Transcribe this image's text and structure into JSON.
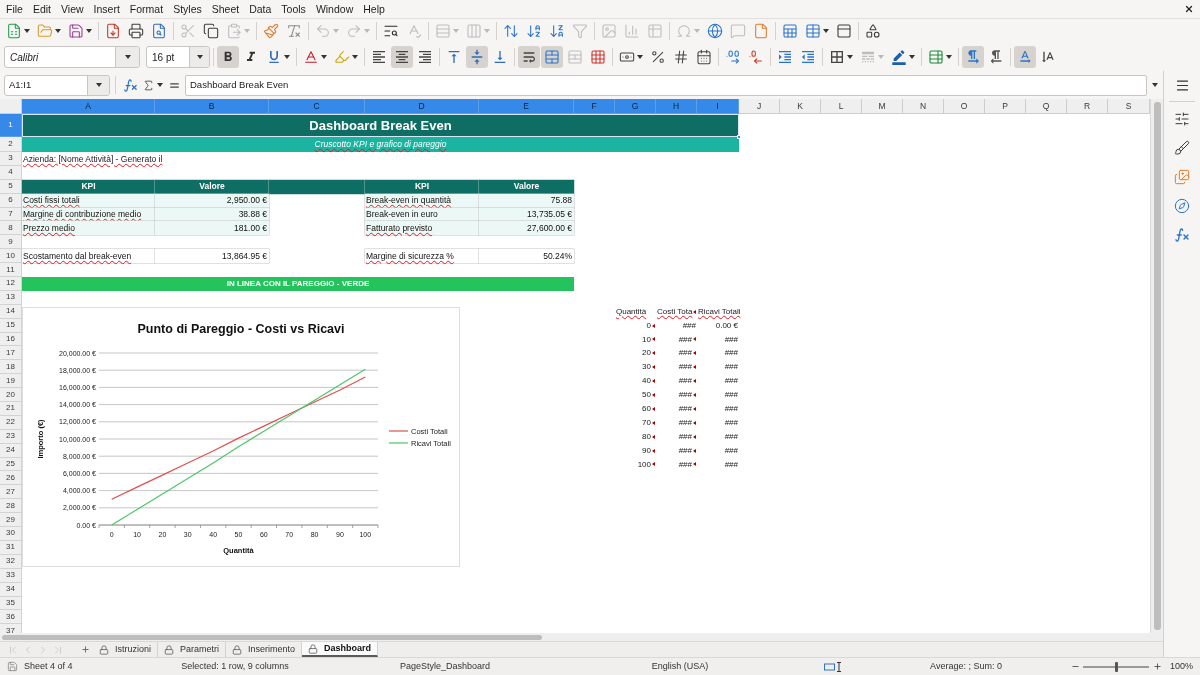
{
  "menu_bar": {
    "items": [
      "File",
      "Edit",
      "View",
      "Insert",
      "Format",
      "Styles",
      "Sheet",
      "Data",
      "Tools",
      "Window",
      "Help"
    ]
  },
  "standard_toolbar": {
    "groups": [
      {
        "buttons": [
          {
            "kind": "new",
            "disabled": false
          },
          {
            "kind": "open",
            "disabled": false
          },
          {
            "kind": "save",
            "disabled": false
          }
        ]
      },
      {
        "buttons": [
          {
            "kind": "export_pdf",
            "disabled": false
          },
          {
            "kind": "print",
            "disabled": false
          },
          {
            "kind": "print_preview",
            "disabled": false
          }
        ]
      },
      {
        "buttons": [
          {
            "kind": "cut",
            "disabled": true
          },
          {
            "kind": "copy",
            "disabled": false
          },
          {
            "kind": "paste",
            "disabled": true
          }
        ]
      },
      {
        "buttons": [
          {
            "kind": "clone_formatting",
            "disabled": false
          },
          {
            "kind": "clear_formatting",
            "disabled": false
          }
        ]
      },
      {
        "buttons": [
          {
            "kind": "undo",
            "disabled": true
          },
          {
            "kind": "redo",
            "disabled": true
          }
        ]
      },
      {
        "buttons": [
          {
            "kind": "find_replace",
            "disabled": false
          },
          {
            "kind": "spelling",
            "disabled": true
          }
        ]
      },
      {
        "buttons": [
          {
            "kind": "rows",
            "disabled": true
          },
          {
            "kind": "columns",
            "disabled": true
          }
        ]
      },
      {
        "buttons": [
          {
            "kind": "sort",
            "disabled": false
          },
          {
            "kind": "sort_ascending",
            "disabled": false
          },
          {
            "kind": "sort_descending",
            "disabled": false
          },
          {
            "kind": "autofilter",
            "disabled": true
          }
        ]
      },
      {
        "buttons": [
          {
            "kind": "image",
            "disabled": true
          },
          {
            "kind": "chart",
            "disabled": true
          },
          {
            "kind": "pivot_table",
            "disabled": true
          }
        ]
      },
      {
        "buttons": [
          {
            "kind": "special_character",
            "disabled": true
          },
          {
            "kind": "hyperlink",
            "disabled": false
          },
          {
            "kind": "comment",
            "disabled": true
          },
          {
            "kind": "headers_footers",
            "disabled": false
          }
        ]
      },
      {
        "buttons": [
          {
            "kind": "print_area",
            "disabled": false
          },
          {
            "kind": "freeze",
            "disabled": false
          },
          {
            "kind": "split_window",
            "disabled": false
          }
        ]
      },
      {
        "buttons": [
          {
            "kind": "draw_functions",
            "disabled": false
          }
        ]
      }
    ]
  },
  "formatting_toolbar": {
    "font_name": "Calibri",
    "font_size": "16 pt",
    "groups": [
      {
        "buttons": [
          {
            "kind": "bold",
            "on": true,
            "disabled": false
          },
          {
            "kind": "italic",
            "on": false,
            "disabled": false
          },
          {
            "kind": "underline",
            "on": false,
            "disabled": false
          }
        ]
      },
      {
        "buttons": [
          {
            "kind": "font_color",
            "on": false,
            "disabled": false
          },
          {
            "kind": "highlight",
            "on": false,
            "disabled": false
          }
        ]
      },
      {
        "buttons": [
          {
            "kind": "align_left",
            "on": false,
            "disabled": false
          },
          {
            "kind": "align_center",
            "on": true,
            "disabled": false
          },
          {
            "kind": "align_right",
            "on": false,
            "disabled": false
          }
        ]
      },
      {
        "buttons": [
          {
            "kind": "align_top",
            "on": false,
            "disabled": false
          },
          {
            "kind": "align_middle",
            "on": true,
            "disabled": false
          },
          {
            "kind": "align_bottom",
            "on": false,
            "disabled": false
          }
        ]
      },
      {
        "buttons": [
          {
            "kind": "wrap_text",
            "on": true,
            "disabled": false
          },
          {
            "kind": "merge_center",
            "on": true,
            "disabled": false
          },
          {
            "kind": "unmerge",
            "on": false,
            "disabled": true
          },
          {
            "kind": "merge",
            "on": false,
            "disabled": false
          }
        ]
      },
      {
        "buttons": [
          {
            "kind": "currency",
            "on": false,
            "disabled": false
          },
          {
            "kind": "percent",
            "on": false,
            "disabled": false
          },
          {
            "kind": "number",
            "on": false,
            "disabled": false
          },
          {
            "kind": "date",
            "on": false,
            "disabled": false
          }
        ]
      },
      {
        "buttons": [
          {
            "kind": "add_decimal",
            "on": false,
            "disabled": false
          },
          {
            "kind": "delete_decimal",
            "on": false,
            "disabled": false
          }
        ]
      },
      {
        "buttons": [
          {
            "kind": "indent_increase",
            "on": false,
            "disabled": false
          },
          {
            "kind": "indent_decrease",
            "on": false,
            "disabled": false
          }
        ]
      },
      {
        "buttons": [
          {
            "kind": "borders",
            "on": false,
            "disabled": false
          },
          {
            "kind": "border_style",
            "on": false,
            "disabled": true
          },
          {
            "kind": "border_color",
            "on": false,
            "disabled": false
          }
        ]
      },
      {
        "buttons": [
          {
            "kind": "conditional",
            "on": false,
            "disabled": false
          }
        ]
      },
      {
        "buttons": [
          {
            "kind": "left_to_right",
            "on": true,
            "disabled": false
          },
          {
            "kind": "right_to_left",
            "on": false,
            "disabled": false
          }
        ]
      },
      {
        "buttons": [
          {
            "kind": "text_horizontal",
            "on": true,
            "disabled": false
          },
          {
            "kind": "text_vertical",
            "on": false,
            "disabled": false
          }
        ]
      }
    ]
  },
  "formula_bar": {
    "name_box": "A1:I1",
    "content": "Dashboard Break Even"
  },
  "sheet": {
    "columns": [
      {
        "label": "A",
        "selected": true
      },
      {
        "label": "B",
        "selected": true
      },
      {
        "label": "C",
        "selected": true
      },
      {
        "label": "D",
        "selected": true
      },
      {
        "label": "E",
        "selected": true
      },
      {
        "label": "F",
        "selected": true
      },
      {
        "label": "G",
        "selected": true
      },
      {
        "label": "H",
        "selected": true
      },
      {
        "label": "I",
        "selected": true
      },
      {
        "label": "J",
        "selected": false
      },
      {
        "label": "K",
        "selected": false
      },
      {
        "label": "L",
        "selected": false
      },
      {
        "label": "M",
        "selected": false
      },
      {
        "label": "N",
        "selected": false
      },
      {
        "label": "O",
        "selected": false
      },
      {
        "label": "P",
        "selected": false
      },
      {
        "label": "Q",
        "selected": false
      },
      {
        "label": "R",
        "selected": false
      },
      {
        "label": "S",
        "selected": false
      }
    ],
    "rows": [
      {
        "label": "1",
        "selected": true
      },
      {
        "label": "2",
        "selected": false
      },
      {
        "label": "3",
        "selected": false
      },
      {
        "label": "4",
        "selected": false
      },
      {
        "label": "5",
        "selected": false
      },
      {
        "label": "6",
        "selected": false
      },
      {
        "label": "7",
        "selected": false
      },
      {
        "label": "8",
        "selected": false
      },
      {
        "label": "9",
        "selected": false
      },
      {
        "label": "10",
        "selected": false
      },
      {
        "label": "11",
        "selected": false
      },
      {
        "label": "12",
        "selected": false
      },
      {
        "label": "13",
        "selected": false
      },
      {
        "label": "14",
        "selected": false
      },
      {
        "label": "15",
        "selected": false
      },
      {
        "label": "16",
        "selected": false
      },
      {
        "label": "17",
        "selected": false
      },
      {
        "label": "18",
        "selected": false
      },
      {
        "label": "19",
        "selected": false
      },
      {
        "label": "20",
        "selected": false
      },
      {
        "label": "21",
        "selected": false
      },
      {
        "label": "22",
        "selected": false
      },
      {
        "label": "23",
        "selected": false
      },
      {
        "label": "24",
        "selected": false
      },
      {
        "label": "25",
        "selected": false
      },
      {
        "label": "26",
        "selected": false
      },
      {
        "label": "27",
        "selected": false
      },
      {
        "label": "28",
        "selected": false
      },
      {
        "label": "29",
        "selected": false
      },
      {
        "label": "30",
        "selected": false
      },
      {
        "label": "31",
        "selected": false
      },
      {
        "label": "32",
        "selected": false
      },
      {
        "label": "33",
        "selected": false
      },
      {
        "label": "34",
        "selected": false
      },
      {
        "label": "35",
        "selected": false
      },
      {
        "label": "36",
        "selected": false
      },
      {
        "label": "37",
        "selected": false
      }
    ],
    "title": {
      "text": "Dashboard Break Even"
    },
    "subtitle": {
      "text": "Cruscotto KPI e grafico di pareggio",
      "spell_error": true
    },
    "note": {
      "text": "Azienda: [Nome Attività] - Generato il",
      "spell_error": true
    },
    "kpi_tables": [
      {
        "headers": [
          "KPI",
          "Valore"
        ],
        "rows": [
          {
            "label": "Costi fissi totali",
            "value": "2,950.00 €",
            "shaded": true,
            "spell_error": true
          },
          {
            "label": "Margine di contribuzione medio",
            "value": "38.88 €",
            "shaded": true,
            "spell_error": true
          },
          {
            "label": "Prezzo medio",
            "value": "181.00 €",
            "shaded": true,
            "spell_error": true
          },
          {
            "label": "Scostamento dal break-even",
            "value": "13,864.95 €",
            "shaded": false,
            "spell_error": true
          }
        ]
      },
      {
        "headers": [
          "KPI",
          "Valore"
        ],
        "rows": [
          {
            "label": "Break-even in quantità",
            "value": "75.88",
            "shaded": true,
            "spell_error": true
          },
          {
            "label": "Break-even in euro",
            "value": "13,735.05 €",
            "shaded": true,
            "spell_error": false
          },
          {
            "label": "Fatturato previsto",
            "value": "27,600.00 €",
            "shaded": true,
            "spell_error": true
          },
          {
            "label": "Margine di sicurezza %",
            "value": "50.24%",
            "shaded": false,
            "spell_error": true
          }
        ]
      }
    ],
    "status_banner": {
      "text": "IN LINEA CON IL PAREGGIO - VERDE"
    },
    "data_table": {
      "columns": [
        {
          "text": "Quantità",
          "spell_error": true,
          "overflow": false
        },
        {
          "text": "Costi Tota",
          "spell_error": true,
          "overflow": true
        },
        {
          "text": "Ricavi Totali",
          "spell_error": true,
          "overflow": false
        }
      ],
      "rows": [
        {
          "cells": [
            {
              "text": "0",
              "overflow": true
            },
            {
              "text": "###",
              "overflow": false
            },
            {
              "text": "0.00 €",
              "overflow": false
            }
          ]
        },
        {
          "cells": [
            {
              "text": "10",
              "overflow": true
            },
            {
              "text": "###",
              "overflow": true
            },
            {
              "text": "###",
              "overflow": false
            }
          ]
        },
        {
          "cells": [
            {
              "text": "20",
              "overflow": true
            },
            {
              "text": "###",
              "overflow": true
            },
            {
              "text": "###",
              "overflow": false
            }
          ]
        },
        {
          "cells": [
            {
              "text": "30",
              "overflow": true
            },
            {
              "text": "###",
              "overflow": true
            },
            {
              "text": "###",
              "overflow": false
            }
          ]
        },
        {
          "cells": [
            {
              "text": "40",
              "overflow": true
            },
            {
              "text": "###",
              "overflow": true
            },
            {
              "text": "###",
              "overflow": false
            }
          ]
        },
        {
          "cells": [
            {
              "text": "50",
              "overflow": true
            },
            {
              "text": "###",
              "overflow": true
            },
            {
              "text": "###",
              "overflow": false
            }
          ]
        },
        {
          "cells": [
            {
              "text": "60",
              "overflow": true
            },
            {
              "text": "###",
              "overflow": true
            },
            {
              "text": "###",
              "overflow": false
            }
          ]
        },
        {
          "cells": [
            {
              "text": "70",
              "overflow": true
            },
            {
              "text": "###",
              "overflow": true
            },
            {
              "text": "###",
              "overflow": false
            }
          ]
        },
        {
          "cells": [
            {
              "text": "80",
              "overflow": true
            },
            {
              "text": "###",
              "overflow": true
            },
            {
              "text": "###",
              "overflow": false
            }
          ]
        },
        {
          "cells": [
            {
              "text": "90",
              "overflow": true
            },
            {
              "text": "###",
              "overflow": true
            },
            {
              "text": "###",
              "overflow": false
            }
          ]
        },
        {
          "cells": [
            {
              "text": "100",
              "overflow": true
            },
            {
              "text": "###",
              "overflow": true
            },
            {
              "text": "###",
              "overflow": false
            }
          ]
        }
      ]
    },
    "chart": {
      "chart_data": {
        "type": "line",
        "title": "Punto di Pareggio - Costi vs Ricavi",
        "xlabel": "Quantità",
        "ylabel": "Importo (€)",
        "categories": [
          "0",
          "10",
          "20",
          "30",
          "40",
          "50",
          "60",
          "70",
          "80",
          "90",
          "100"
        ],
        "series": [
          {
            "name": "Costi Totali",
            "color": "#e0504e",
            "values": [
              3000,
              4400,
              5800,
              7200,
              8600,
              10100,
              11500,
              12900,
              14300,
              15700,
              17200
            ]
          },
          {
            "name": "Ricavi Totali",
            "color": "#4cc66a",
            "values": [
              0,
              1800,
              3600,
              5400,
              7200,
              9100,
              10900,
              12700,
              14500,
              16300,
              18100
            ]
          }
        ],
        "ylim": [
          0,
          20000
        ],
        "yticks": [
          {
            "value": 0,
            "label": "0.00 €"
          },
          {
            "value": 2000,
            "label": "2,000.00 €"
          },
          {
            "value": 4000,
            "label": "4,000.00 €"
          },
          {
            "value": 6000,
            "label": "6,000.00 €"
          },
          {
            "value": 8000,
            "label": "8,000.00 €"
          },
          {
            "value": 10000,
            "label": "10,000.00 €"
          },
          {
            "value": 12000,
            "label": "12,000.00 €"
          },
          {
            "value": 14000,
            "label": "14,000.00 €"
          },
          {
            "value": 16000,
            "label": "16,000.00 €"
          },
          {
            "value": 18000,
            "label": "18,000.00 €"
          },
          {
            "value": 20000,
            "label": "20,000.00 €"
          }
        ],
        "grid": true,
        "legend": true
      }
    }
  },
  "sheet_tab_bar": {
    "navigation": [
      {
        "kind": "first",
        "disabled": true
      },
      {
        "kind": "previous",
        "disabled": true
      },
      {
        "kind": "next",
        "disabled": true
      },
      {
        "kind": "last",
        "disabled": true
      }
    ],
    "tabs": [
      {
        "label": "Istruzioni",
        "selected": false,
        "protected": true
      },
      {
        "label": "Parametri",
        "selected": false,
        "protected": true
      },
      {
        "label": "Inserimento",
        "selected": false,
        "protected": true
      },
      {
        "label": "Dashboard",
        "selected": true,
        "protected": true
      }
    ]
  },
  "status_bar": {
    "sheet": "Sheet 4 of 4",
    "selection": "Selected: 1 row, 9 columns",
    "page_style": "PageStyle_Dashboard",
    "language": "English (USA)",
    "summary": "Average: ; Sum: 0",
    "zoom": {
      "level": 0.5,
      "reading": "100%"
    }
  }
}
